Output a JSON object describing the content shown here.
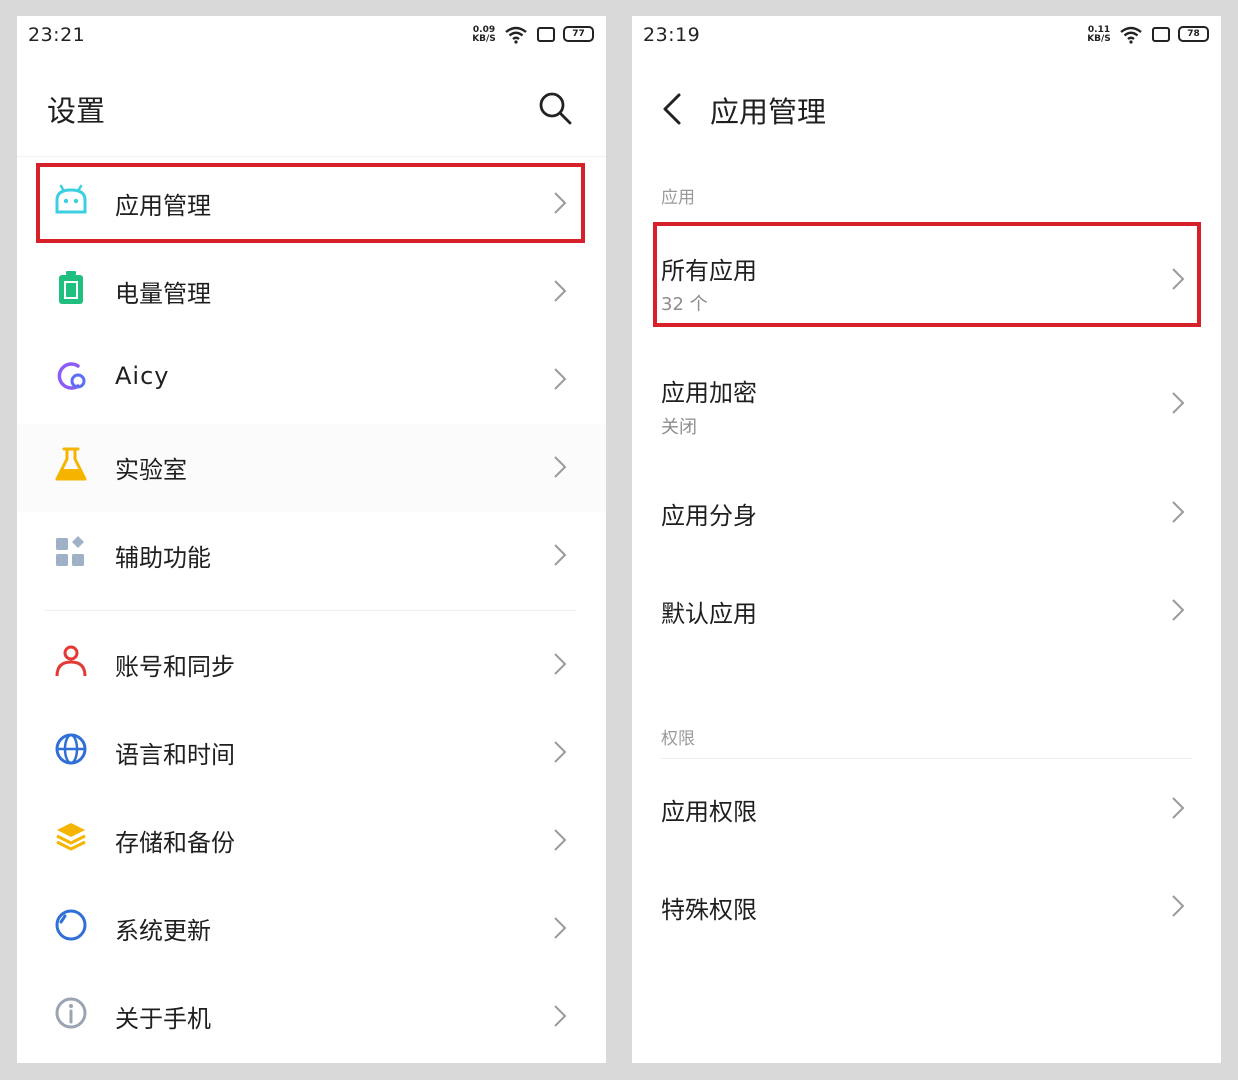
{
  "left": {
    "status": {
      "time": "23:21",
      "speed_top": "0.09",
      "speed_bottom": "KB/S",
      "battery": "77"
    },
    "title": "设置",
    "items": [
      {
        "label": "应用管理",
        "icon": "android-icon"
      },
      {
        "label": "电量管理",
        "icon": "battery-icon"
      },
      {
        "label": "Aicy",
        "icon": "aicy-icon"
      },
      {
        "label": "实验室",
        "icon": "flask-icon"
      },
      {
        "label": "辅助功能",
        "icon": "grid-icon"
      },
      {
        "label": "账号和同步",
        "icon": "person-icon"
      },
      {
        "label": "语言和时间",
        "icon": "globe-icon"
      },
      {
        "label": "存储和备份",
        "icon": "layers-icon"
      },
      {
        "label": "系统更新",
        "icon": "update-icon"
      },
      {
        "label": "关于手机",
        "icon": "info-icon"
      }
    ]
  },
  "right": {
    "status": {
      "time": "23:19",
      "speed_top": "0.11",
      "speed_bottom": "KB/S",
      "battery": "78"
    },
    "title": "应用管理",
    "section_apps": "应用",
    "all_apps": {
      "label": "所有应用",
      "sub": "32 个"
    },
    "app_lock": {
      "label": "应用加密",
      "sub": "关闭"
    },
    "app_clone": {
      "label": "应用分身"
    },
    "default_apps": {
      "label": "默认应用"
    },
    "section_perm": "权限",
    "app_perm": {
      "label": "应用权限"
    },
    "special_perm": {
      "label": "特殊权限"
    }
  },
  "colors": {
    "highlight": "#d6202a",
    "android": "#3ccfe0",
    "battery": "#1fbf80",
    "aicy": "#8b5cf6",
    "flask": "#f5b400",
    "person": "#e53935",
    "globe": "#2f6fd6",
    "layers": "#f5b400",
    "update": "#2f6fd6",
    "info": "#9aa4b2"
  }
}
